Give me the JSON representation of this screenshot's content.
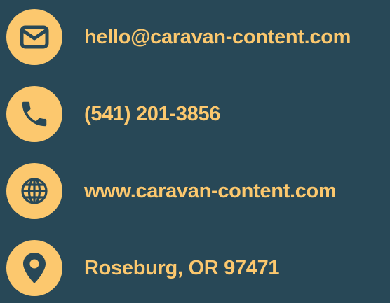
{
  "colors": {
    "background": "#284857",
    "accent": "#fcc86e",
    "icon_stroke": "#284857"
  },
  "contacts": [
    {
      "icon": "envelope-icon",
      "text": "hello@caravan-content.com"
    },
    {
      "icon": "phone-icon",
      "text": "(541) 201-3856"
    },
    {
      "icon": "globe-icon",
      "text": "www.caravan-content.com"
    },
    {
      "icon": "map-pin-icon",
      "text": "Roseburg, OR 97471"
    }
  ]
}
